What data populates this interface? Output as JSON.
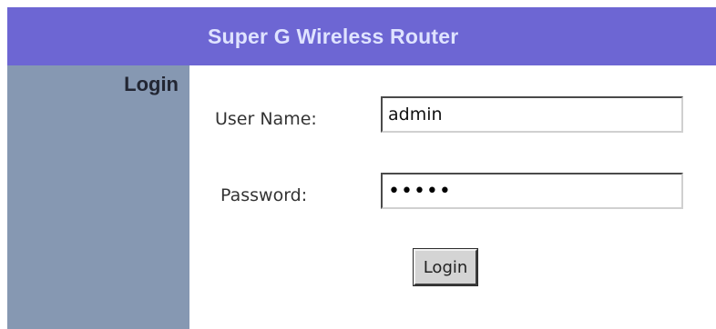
{
  "header": {
    "title": "Super G Wireless Router"
  },
  "sidebar": {
    "title": "Login"
  },
  "form": {
    "username_label": "User Name:",
    "username_value": "admin",
    "password_label": "Password:",
    "password_value": "admin",
    "login_button_label": "Login"
  },
  "colors": {
    "header_background": "#6d66d3",
    "header_text": "#dfe3ff",
    "sidebar_background": "#8698b2",
    "button_background": "#d4d4d4"
  }
}
